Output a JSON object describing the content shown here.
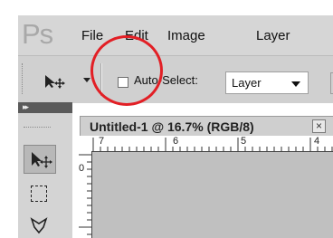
{
  "app": {
    "logo": "Ps"
  },
  "menubar": {
    "items": [
      "File",
      "Edit",
      "Image",
      "Layer"
    ]
  },
  "options": {
    "auto_select_label": "Auto-Select:",
    "auto_select_checked": false,
    "target_value": "Layer"
  },
  "tools_panel": {
    "collapse_glyph": "▸▸"
  },
  "document": {
    "title": "Untitled-1 @ 16.7% (RGB/8)",
    "close_glyph": "×",
    "ruler_h_labels": [
      "7",
      "6",
      "5",
      "4"
    ],
    "ruler_v_labels": [
      "0"
    ]
  },
  "colors": {
    "highlight": "#e21f25",
    "menubar_bg": "#d6d6d6",
    "canvas_bg": "#c0c0c0"
  }
}
